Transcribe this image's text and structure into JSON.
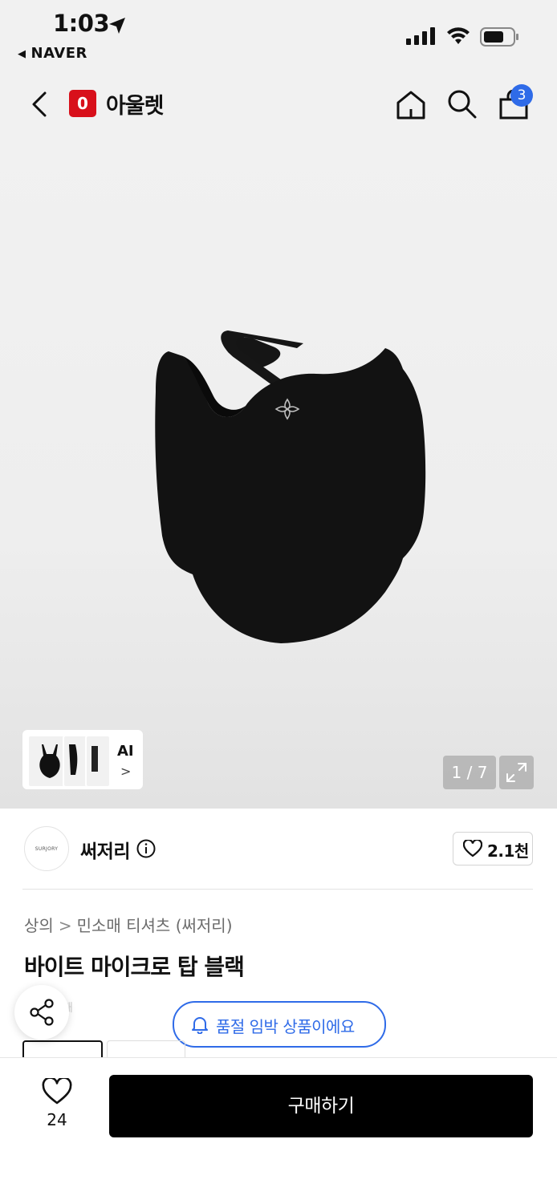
{
  "status_bar": {
    "time": "1:03",
    "back_app": "NAVER"
  },
  "header": {
    "brand_logo_letter": "0",
    "brand_name": "아울렛",
    "cart_count": "3"
  },
  "gallery": {
    "ai_label": "AI",
    "page_counter": "1 / 7"
  },
  "seller": {
    "logo_text": "SURJORY",
    "name": "써저리",
    "likes": "2.1천"
  },
  "product": {
    "breadcrumb": [
      "상의",
      "민소매 티셔츠 (써저리)"
    ],
    "title": "바이트 마이크로 탑 블랙",
    "peek_text": "쾌"
  },
  "soldout_notice": "품절 임박 상품이에요",
  "bottom_bar": {
    "wish_count": "24",
    "buy_label": "구매하기"
  },
  "colors": {
    "accent_blue": "#2f6be8",
    "brand_red": "#d8101b",
    "buy_button": "#000000"
  }
}
